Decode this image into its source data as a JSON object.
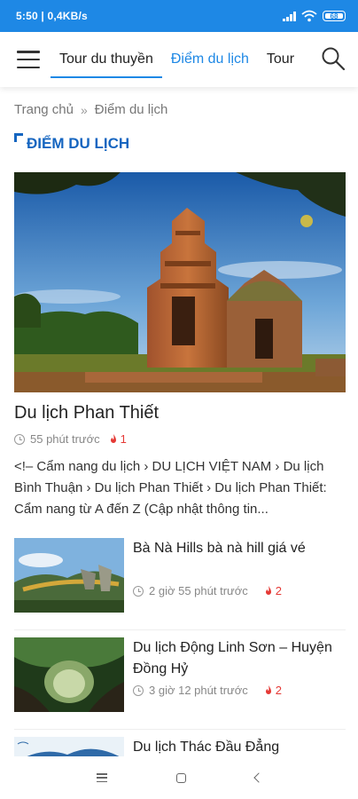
{
  "status_bar": {
    "time_speed": "5:50 | 0,4KB/s",
    "battery": "68"
  },
  "nav": {
    "tabs": [
      {
        "label": "Tour du thuyền"
      },
      {
        "label": "Điểm du lịch"
      },
      {
        "label": "Tour"
      }
    ],
    "active_tab": "Điểm du lịch",
    "accent_color": "#1e88e5"
  },
  "breadcrumb": {
    "home": "Trang chủ",
    "separator": "»",
    "current": "Điểm du lịch"
  },
  "section": {
    "title": "ĐIỂM DU LỊCH"
  },
  "featured": {
    "title": "Du lịch Phan Thiết",
    "time": "55 phút trước",
    "views": "1",
    "excerpt": "<!– Cẩm nang du lịch › DU LỊCH VIỆT NAM › Du lịch Bình Thuận › Du lịch Phan Thiết › Du lịch Phan Thiết: Cẩm nang từ A đến Z (Cập nhật thông tin..."
  },
  "articles": [
    {
      "title": "Bà Nà Hills bà nà hill giá vé",
      "time": "2 giờ 55 phút trước",
      "views": "2"
    },
    {
      "title": "Du lịch Động Linh Sơn – Huyện Đồng Hỷ",
      "time": "3 giờ 12 phút trước",
      "views": "2"
    },
    {
      "title": "Du lịch Thác Đầu Đẳng",
      "time": "",
      "views": ""
    }
  ],
  "icons": {
    "menu": "hamburger-icon",
    "search": "search-icon",
    "clock": "clock-icon",
    "views": "fire-icon"
  }
}
